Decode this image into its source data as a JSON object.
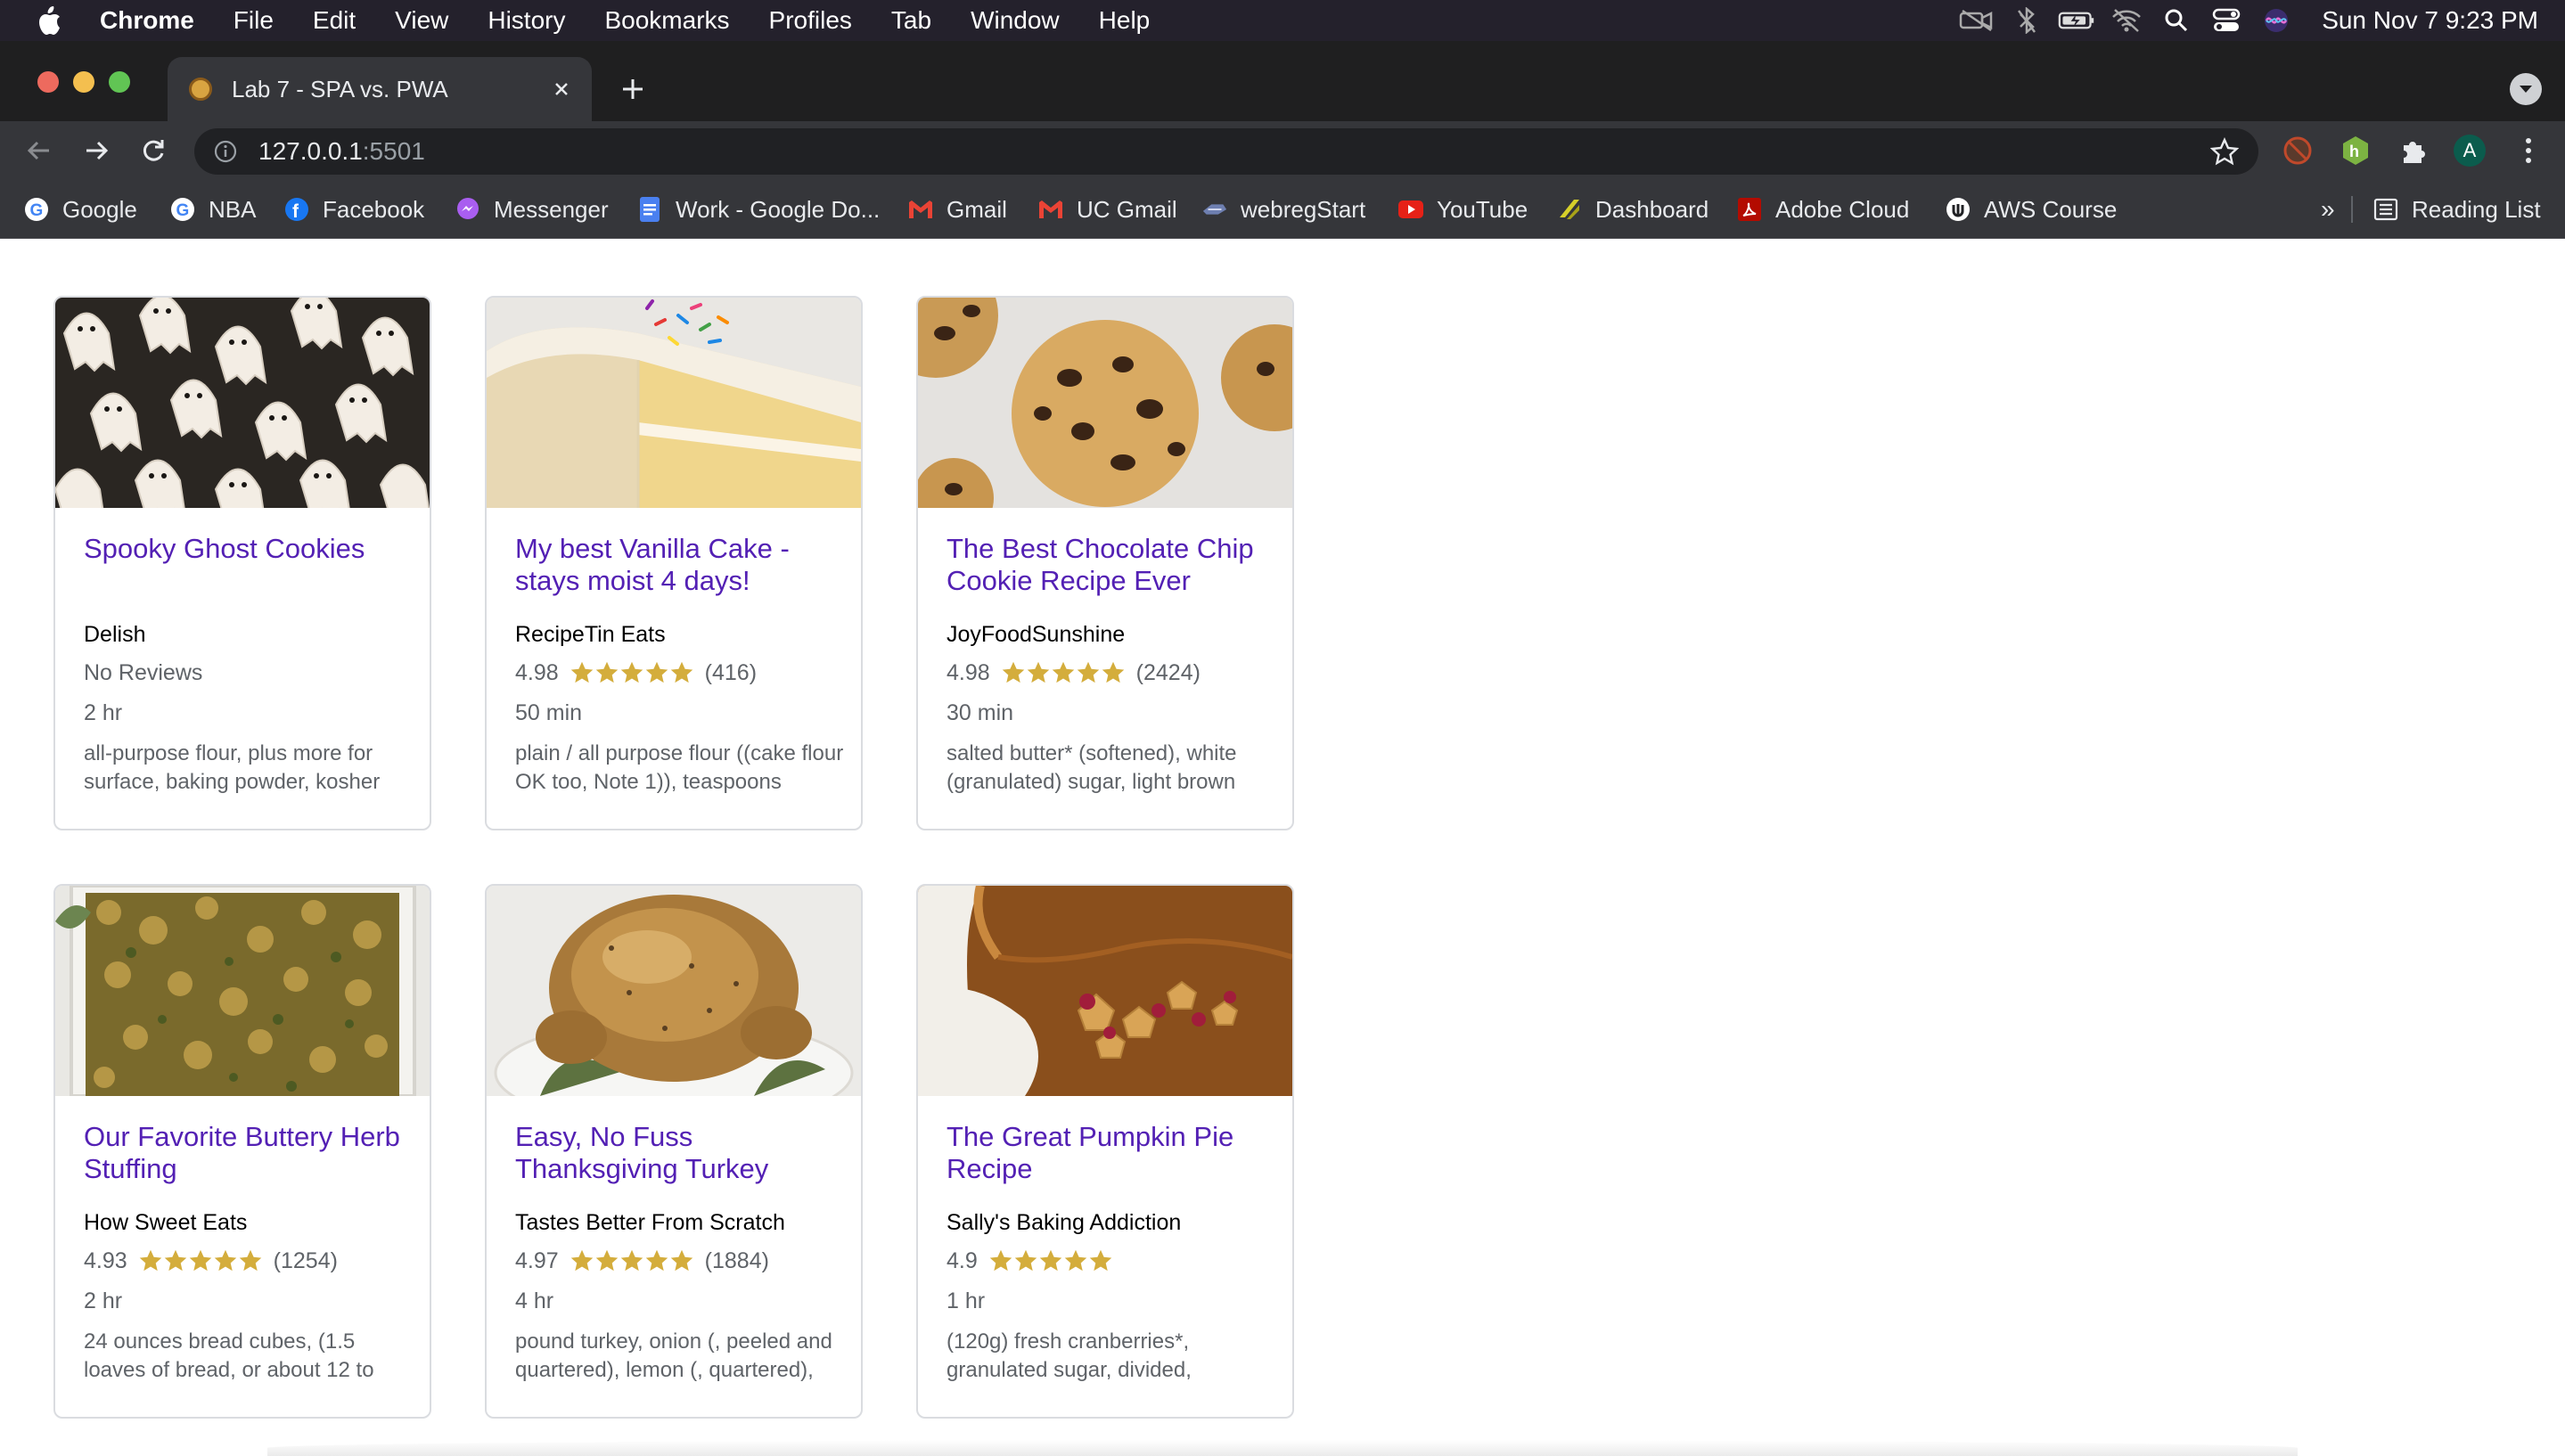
{
  "menubar": {
    "app": "Chrome",
    "items": [
      "File",
      "Edit",
      "View",
      "History",
      "Bookmarks",
      "Profiles",
      "Tab",
      "Window",
      "Help"
    ],
    "clock": "Sun Nov 7  9:23 PM"
  },
  "tab": {
    "title": "Lab 7 - SPA vs. PWA"
  },
  "omnibox": {
    "host": "127.0.0.1",
    "port": ":5501"
  },
  "profile": {
    "initial": "A"
  },
  "bookmarks": {
    "items": [
      {
        "label": "Google",
        "icon": "google-icon"
      },
      {
        "label": "NBA",
        "icon": "google-icon"
      },
      {
        "label": "Facebook",
        "icon": "facebook-icon"
      },
      {
        "label": "Messenger",
        "icon": "messenger-icon"
      },
      {
        "label": "Work - Google Do...",
        "icon": "google-docs-icon"
      },
      {
        "label": "Gmail",
        "icon": "gmail-icon"
      },
      {
        "label": "UC Gmail",
        "icon": "gmail-icon"
      },
      {
        "label": "webregStart",
        "icon": "webreg-icon"
      },
      {
        "label": "YouTube",
        "icon": "youtube-icon"
      },
      {
        "label": "Dashboard",
        "icon": "dashboard-icon"
      },
      {
        "label": "Adobe  Cloud",
        "icon": "adobe-icon"
      },
      {
        "label": "AWS Course",
        "icon": "aws-icon"
      }
    ],
    "overflow": "»",
    "reading_list": "Reading List"
  },
  "cards": [
    {
      "title": "Spooky Ghost Cookies",
      "org": "Delish",
      "rating": "",
      "no_reviews": "No Reviews",
      "stars": 0,
      "count": "",
      "time": "2 hr",
      "ingredients": "all-purpose flour, plus more for surface, baking powder, kosher",
      "image": "ghost-cookies"
    },
    {
      "title": "My best Vanilla Cake - stays moist 4 days!",
      "org": "RecipeTin Eats",
      "rating": "4.98",
      "no_reviews": "",
      "stars": 5,
      "count": "(416)",
      "time": "50 min",
      "ingredients": "plain / all purpose flour ((cake flour OK too, Note 1)), teaspoons",
      "image": "vanilla-cake"
    },
    {
      "title": "The Best Chocolate Chip Cookie Recipe Ever",
      "org": "JoyFoodSunshine",
      "rating": "4.98",
      "no_reviews": "",
      "stars": 5,
      "count": "(2424)",
      "time": "30 min",
      "ingredients": "salted butter* (softened), white (granulated) sugar, light brown",
      "image": "chocolate-chip-cookies"
    },
    {
      "title": "Our Favorite Buttery Herb Stuffing",
      "org": "How Sweet Eats",
      "rating": "4.93",
      "no_reviews": "",
      "stars": 5,
      "count": "(1254)",
      "time": "2 hr",
      "ingredients": "24 ounces bread cubes, (1.5 loaves of bread, or about 12 to",
      "image": "herb-stuffing"
    },
    {
      "title": "Easy, No Fuss Thanksgiving Turkey",
      "org": "Tastes Better From Scratch",
      "rating": "4.97",
      "no_reviews": "",
      "stars": 5,
      "count": "(1884)",
      "time": "4 hr",
      "ingredients": "pound turkey, onion (, peeled and quartered), lemon (, quartered),",
      "image": "thanksgiving-turkey"
    },
    {
      "title": "The Great Pumpkin Pie Recipe",
      "org": "Sally's Baking Addiction",
      "rating": "4.9",
      "no_reviews": "",
      "stars": 5,
      "count": "",
      "time": "1 hr",
      "ingredients": "(120g) fresh cranberries*, granulated sugar, divided,",
      "image": "pumpkin-pie"
    }
  ],
  "colors": {
    "title_link": "#5320b4",
    "star": "#d4ad3c",
    "menubar": "#24212c",
    "chrome_dark": "#35363a"
  }
}
